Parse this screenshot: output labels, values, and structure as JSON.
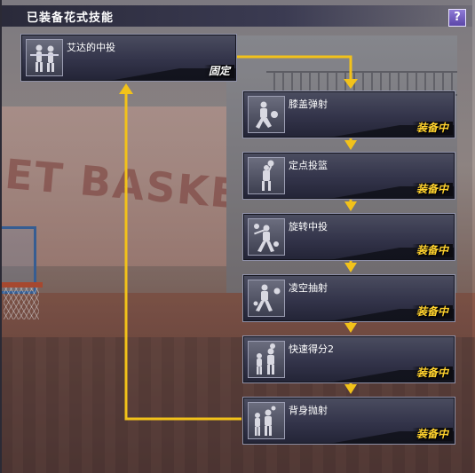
{
  "panel": {
    "title": "已装备花式技能",
    "help_label": "?"
  },
  "background": {
    "mural_text": "ET BASKETBA"
  },
  "skills": [
    {
      "name": "艾达的中投",
      "status": "固定",
      "icon": "two-players-shooting-icon"
    },
    {
      "name": "膝盖弹射",
      "status": "装备中",
      "icon": "player-knee-bounce-icon"
    },
    {
      "name": "定点投篮",
      "status": "装备中",
      "icon": "player-spot-shot-icon"
    },
    {
      "name": "旋转中投",
      "status": "装备中",
      "icon": "player-spin-shot-icon"
    },
    {
      "name": "凌空抽射",
      "status": "装备中",
      "icon": "player-volley-shot-icon"
    },
    {
      "name": "快速得分2",
      "status": "装备中",
      "icon": "player-quick-score-icon"
    },
    {
      "name": "背身抛射",
      "status": "装备中",
      "icon": "player-back-toss-icon"
    }
  ],
  "colors": {
    "arrow": "#f2c21a",
    "equipped_badge": "#ffd22e",
    "fixed_badge": "#ffffff",
    "help_button": "#6a55b8"
  }
}
